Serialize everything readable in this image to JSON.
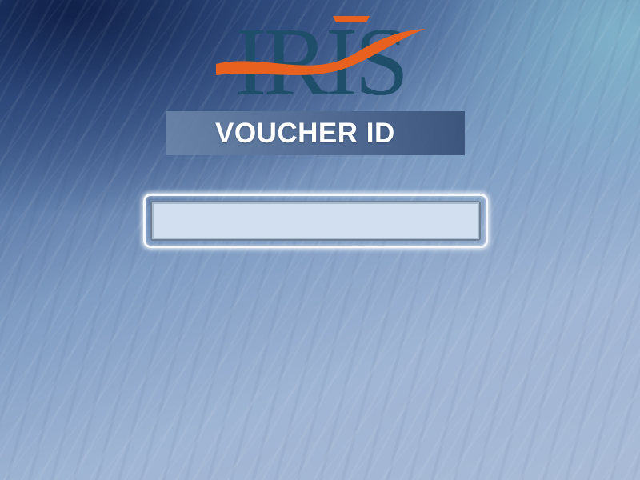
{
  "app": {
    "logo_text": "IRIS",
    "logo_icon": "iris-logo-icon"
  },
  "header": {
    "title": "VOUCHER ID"
  },
  "voucher_input": {
    "value": "",
    "placeholder": ""
  },
  "colors": {
    "logo_letters": "#1f4e6b",
    "logo_swoosh": "#e8611f",
    "banner_text": "#ffffff",
    "input_background": "#d2dff0"
  }
}
